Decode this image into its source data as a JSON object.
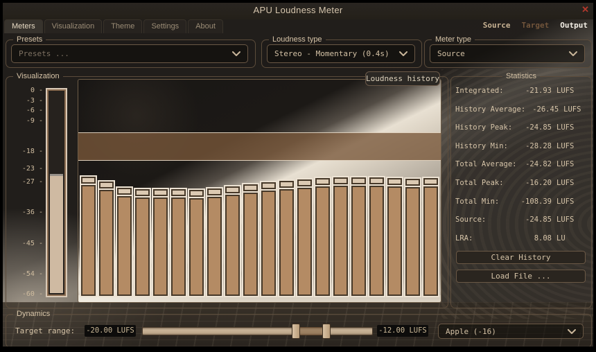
{
  "title_bar": {
    "title": "APU Loudness Meter",
    "close_label": "✕"
  },
  "tabs": {
    "left": [
      "Meters",
      "Visualization",
      "Theme",
      "Settings",
      "About"
    ],
    "active_left": "Meters",
    "right": [
      "Source",
      "Target",
      "Output"
    ],
    "active_right": "Output"
  },
  "presets": {
    "label": "Presets",
    "value": "Presets ..."
  },
  "loudness_type": {
    "label": "Loudness type",
    "value": "Stereo - Momentary (0.4s)"
  },
  "meter_type": {
    "label": "Meter type",
    "value": "Source"
  },
  "visualization": {
    "label": "Visualization",
    "history_label": "Loudness history"
  },
  "statistics": {
    "label": "Statistics",
    "rows": [
      {
        "name": "Integrated:",
        "value": "-21.93",
        "unit": "LUFS"
      },
      {
        "name": "History Average:",
        "value": "-26.45",
        "unit": "LUFS"
      },
      {
        "name": "History Peak:",
        "value": "-24.85",
        "unit": "LUFS"
      },
      {
        "name": "History Min:",
        "value": "-28.28",
        "unit": "LUFS"
      },
      {
        "name": "Total Average:",
        "value": "-24.82",
        "unit": "LUFS"
      },
      {
        "name": "Total Peak:",
        "value": "-16.20",
        "unit": "LUFS"
      },
      {
        "name": "Total Min:",
        "value": "-108.39",
        "unit": "LUFS"
      },
      {
        "name": "Source:",
        "value": "-24.85",
        "unit": "LUFS"
      },
      {
        "name": "LRA:",
        "value": "8.08",
        "unit": "LU"
      }
    ],
    "clear_button": "Clear History",
    "load_button": "Load File ..."
  },
  "dynamics": {
    "label": "Dynamics",
    "target_range_label": "Target range:",
    "low_text": "-20.00 LUFS",
    "high_text": "-12.00 LUFS",
    "low_value": -20,
    "high_value": -12,
    "slider_min": -60,
    "slider_max": 0,
    "preset_value": "Apple (-16)"
  },
  "chart_data": {
    "type": "bar",
    "title": "Loudness history",
    "ylabel": "LUFS",
    "ylim": [
      0,
      -60
    ],
    "grid": false,
    "legend_position": "none",
    "axis_ticks": [
      0,
      -3,
      -6,
      -9,
      -18,
      -23,
      -27,
      -36,
      -45,
      -54,
      -60
    ],
    "values": [
      -24.85,
      -26.1,
      -27.75,
      -28.1,
      -28.1,
      -28.1,
      -28.28,
      -27.9,
      -27.4,
      -26.8,
      -26.3,
      -25.9,
      -25.6,
      -25.2,
      -25.0,
      -25.0,
      -25.0,
      -25.2,
      -25.35,
      -25.2
    ],
    "meter_value": -24.85,
    "target_range": [
      -20,
      -12
    ]
  },
  "colors": {
    "accent_text": "#d6c4a8",
    "bar_fill": "#b48b64",
    "bar_cap": "#dbc9b2",
    "meter_fill": "#cfbaa2",
    "target_band": "#78573a",
    "close_red": "#b5382c",
    "toggle_source": "#c8b293",
    "toggle_target": "#71543b",
    "toggle_output": "#f4efe6"
  }
}
